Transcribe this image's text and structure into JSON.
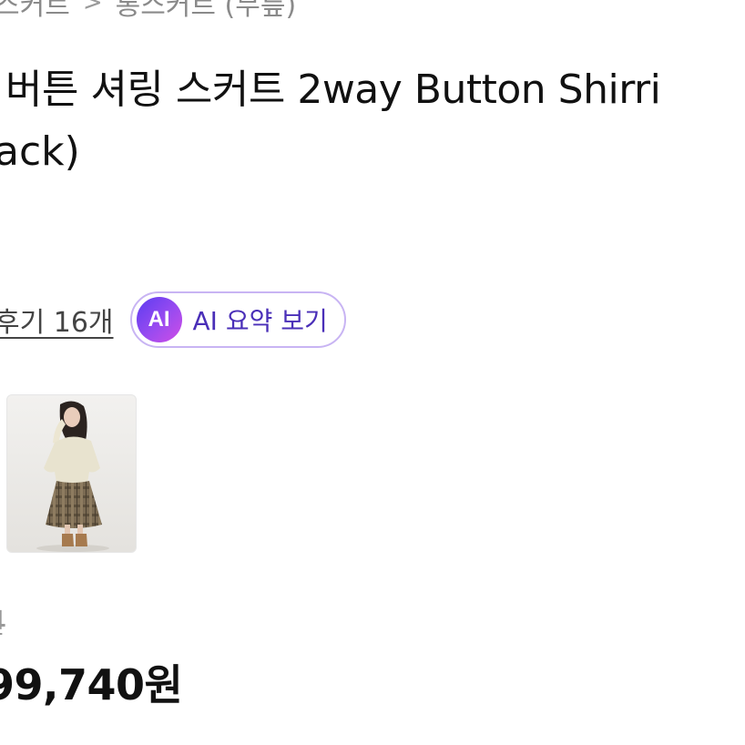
{
  "breadcrumb": {
    "parent": "스커트",
    "separator": ">",
    "current": "롱스커트 (무릎)"
  },
  "product": {
    "title_line1": "버튼 셔링 스커트 2way Button Shirri",
    "title_line2": "ack)"
  },
  "reviews": {
    "link_label": "후기 16개"
  },
  "ai_summary": {
    "badge": "AI",
    "label": "AI 요약 보기"
  },
  "thumbnail": {
    "alt": "product-thumbnail"
  },
  "price": {
    "original": "원",
    "sale": "99,740원"
  }
}
